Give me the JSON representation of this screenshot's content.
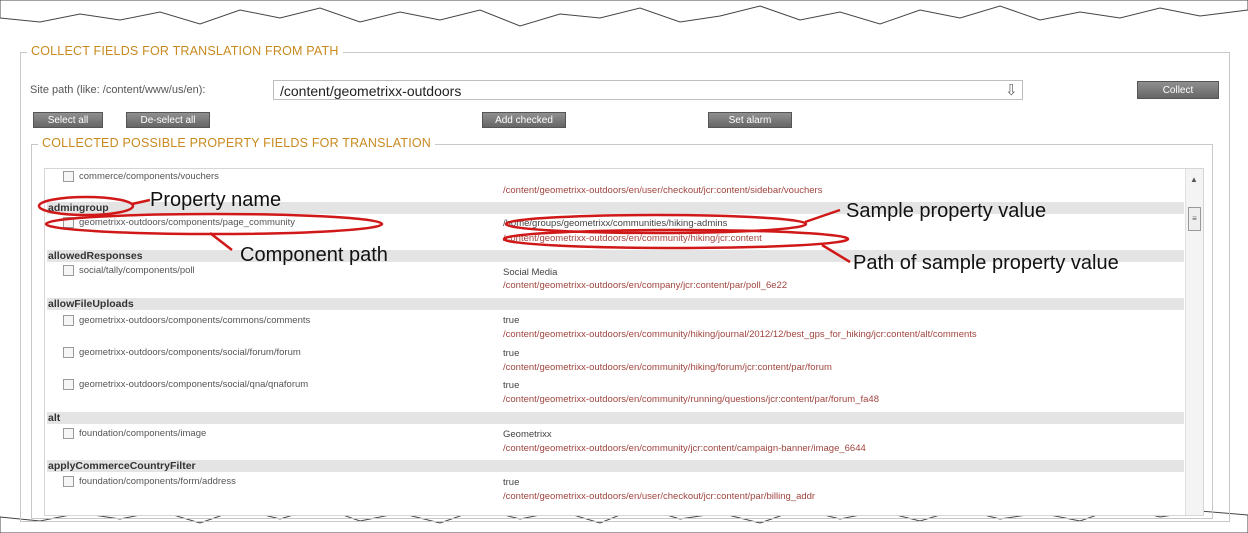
{
  "section_collect": {
    "legend": "COLLECT FIELDS FOR TRANSLATION FROM PATH",
    "site_path_label": "Site path (like: /content/www/us/en):",
    "site_path_value": "/content/geometrixx-outdoors",
    "collect_button": "Collect",
    "select_all_button": "Select all",
    "deselect_all_button": "De-select all",
    "add_checked_button": "Add checked",
    "set_alarm_button": "Set alarm"
  },
  "section_collected": {
    "legend": "COLLECTED POSSIBLE PROPERTY FIELDS FOR TRANSLATION"
  },
  "list": {
    "top_component": "commerce/components/vouchers",
    "top_path": "/content/geometrixx-outdoors/en/user/checkout/jcr:content/sidebar/vouchers",
    "groups": [
      {
        "name": "admingroup",
        "rows": [
          {
            "component": "geometrixx-outdoors/components/page_community",
            "value": "/home/groups/geometrixx/communities/hiking-admins",
            "path": "/content/geometrixx-outdoors/en/community/hiking/jcr:content"
          }
        ]
      },
      {
        "name": "allowedResponses",
        "rows": [
          {
            "component": "social/tally/components/poll",
            "value": "Social Media",
            "path": "/content/geometrixx-outdoors/en/company/jcr:content/par/poll_6e22"
          }
        ]
      },
      {
        "name": "allowFileUploads",
        "rows": [
          {
            "component": "geometrixx-outdoors/components/commons/comments",
            "value": "true",
            "path": "/content/geometrixx-outdoors/en/community/hiking/journal/2012/12/best_gps_for_hiking/jcr:content/alt/comments"
          },
          {
            "component": "geometrixx-outdoors/components/social/forum/forum",
            "value": "true",
            "path": "/content/geometrixx-outdoors/en/community/hiking/forum/jcr:content/par/forum"
          },
          {
            "component": "geometrixx-outdoors/components/social/qna/qnaforum",
            "value": "true",
            "path": "/content/geometrixx-outdoors/en/community/running/questions/jcr:content/par/forum_fa48"
          }
        ]
      },
      {
        "name": "alt",
        "rows": [
          {
            "component": "foundation/components/image",
            "value": "Geometrixx",
            "path": "/content/geometrixx-outdoors/en/community/jcr:content/campaign-banner/image_6644"
          }
        ]
      },
      {
        "name": "applyCommerceCountryFilter",
        "rows": [
          {
            "component": "foundation/components/form/address",
            "value": "true",
            "path": "/content/geometrixx-outdoors/en/user/checkout/jcr:content/par/billing_addr"
          }
        ]
      }
    ]
  },
  "annotations": {
    "property_name": "Property name",
    "component_path": "Component path",
    "sample_value": "Sample property value",
    "sample_value_path": "Path of sample property value"
  },
  "colors": {
    "legend": "#c98a1f",
    "path_text": "#a0453f",
    "annotation_red": "#d01818"
  }
}
